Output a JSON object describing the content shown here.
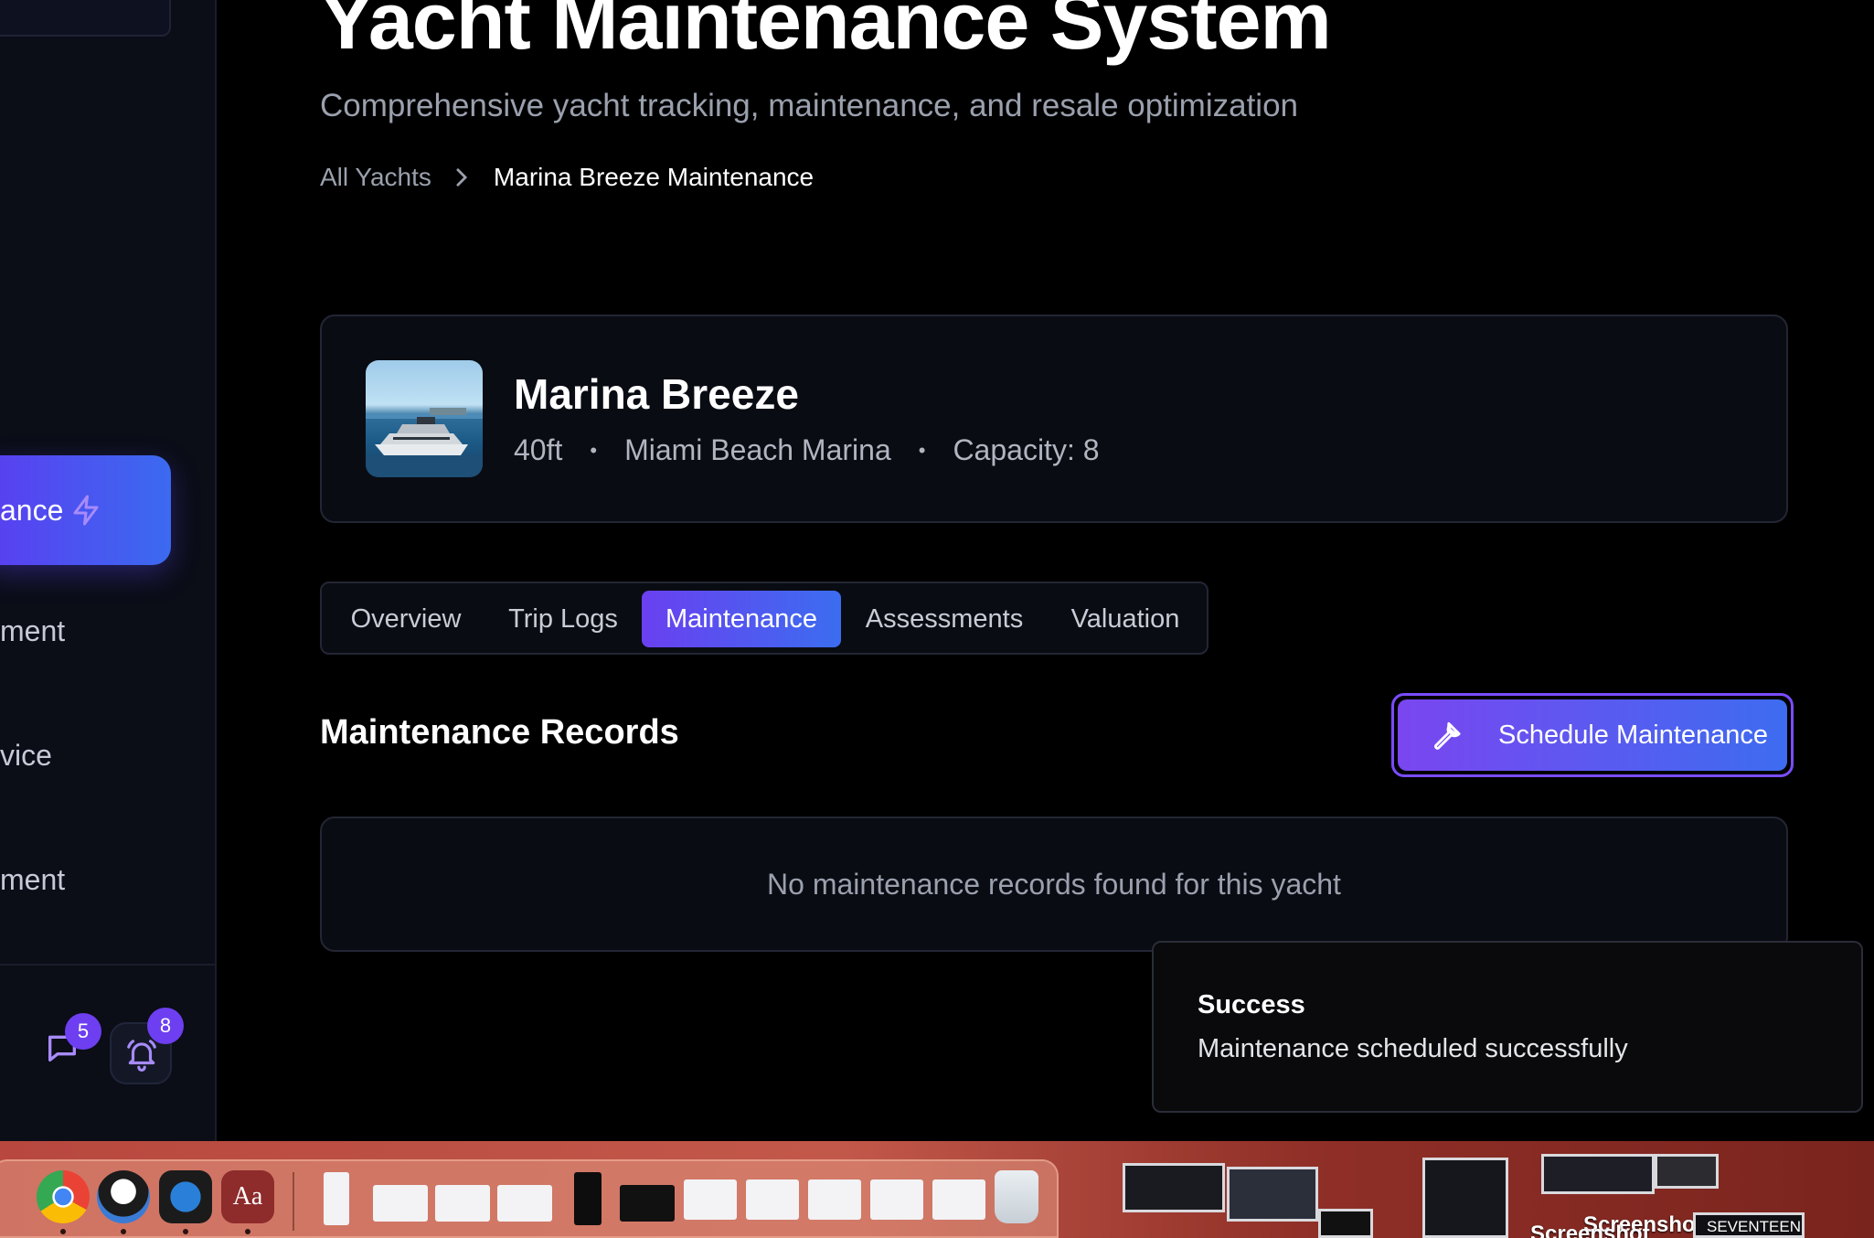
{
  "app": {
    "title": "Yacht Maintenance System",
    "subtitle": "Comprehensive yacht tracking, maintenance, and resale optimization"
  },
  "breadcrumb": {
    "root": "All Yachts",
    "current": "Marina Breeze Maintenance"
  },
  "sidebar": {
    "active_item": "ance",
    "items": [
      "ment",
      "vice",
      "ment"
    ],
    "chat_badge": "5",
    "notification_badge": "8"
  },
  "yacht": {
    "name": "Marina Breeze",
    "length": "40ft",
    "location": "Miami Beach Marina",
    "capacity": "Capacity: 8",
    "separator": "•"
  },
  "tabs": [
    {
      "label": "Overview",
      "active": false
    },
    {
      "label": "Trip Logs",
      "active": false
    },
    {
      "label": "Maintenance",
      "active": true
    },
    {
      "label": "Assessments",
      "active": false
    },
    {
      "label": "Valuation",
      "active": false
    }
  ],
  "maintenance": {
    "section_title": "Maintenance Records",
    "schedule_button": "Schedule Maintenance",
    "empty_message": "No maintenance records found for this yacht"
  },
  "toast": {
    "title": "Success",
    "message": "Maintenance scheduled successfully"
  },
  "desktop": {
    "labels": [
      "Screenshot",
      "Screenshot",
      "SEVENTEEN"
    ]
  },
  "colors": {
    "accent_start": "#6a40f0",
    "accent_end": "#3b6df0",
    "background": "#000000",
    "card": "#0a0c13"
  }
}
